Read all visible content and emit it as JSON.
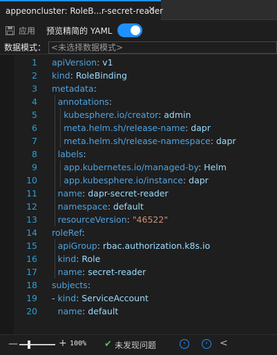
{
  "tab": {
    "title": "appeoncluster: RoleB...r-secret-reader",
    "close_glyph": "✕"
  },
  "toolbar": {
    "apply_label": "应用",
    "simplified_label": "预览精简的 YAML",
    "simplified_enabled": true
  },
  "mode": {
    "label": "数据模式：",
    "placeholder": "<未选择数据模式>"
  },
  "editor": {
    "lines": [
      {
        "n": "1",
        "indent": 0,
        "key": "apiVersion",
        "val": "v1",
        "type": "v"
      },
      {
        "n": "2",
        "indent": 0,
        "key": "kind",
        "val": "RoleBinding",
        "type": "v"
      },
      {
        "n": "3",
        "indent": 0,
        "key": "metadata",
        "val": "",
        "type": "v"
      },
      {
        "n": "4",
        "indent": 1,
        "key": "annotations",
        "val": "",
        "type": "v"
      },
      {
        "n": "5",
        "indent": 2,
        "key": "kubesphere.io/creator",
        "val": "admin",
        "type": "v"
      },
      {
        "n": "6",
        "indent": 2,
        "key": "meta.helm.sh/release-name",
        "val": "dapr",
        "type": "v"
      },
      {
        "n": "7",
        "indent": 2,
        "key": "meta.helm.sh/release-namespace",
        "val": "dapr",
        "type": "v"
      },
      {
        "n": "8",
        "indent": 1,
        "key": "labels",
        "val": "",
        "type": "v"
      },
      {
        "n": "9",
        "indent": 2,
        "key": "app.kubernetes.io/managed-by",
        "val": "Helm",
        "type": "v"
      },
      {
        "n": "10",
        "indent": 2,
        "key": "app.kubesphere.io/instance",
        "val": "dapr",
        "type": "v"
      },
      {
        "n": "11",
        "indent": 1,
        "key": "name",
        "val": "dapr-secret-reader",
        "type": "v"
      },
      {
        "n": "12",
        "indent": 1,
        "key": "namespace",
        "val": "default",
        "type": "v"
      },
      {
        "n": "13",
        "indent": 1,
        "key": "resourceVersion",
        "val": "\"46522\"",
        "type": "s"
      },
      {
        "n": "14",
        "indent": 0,
        "key": "roleRef",
        "val": "",
        "type": "v"
      },
      {
        "n": "15",
        "indent": 1,
        "key": "apiGroup",
        "val": "rbac.authorization.k8s.io",
        "type": "v"
      },
      {
        "n": "16",
        "indent": 1,
        "key": "kind",
        "val": "Role",
        "type": "v"
      },
      {
        "n": "17",
        "indent": 1,
        "key": "name",
        "val": "secret-reader",
        "type": "v"
      },
      {
        "n": "18",
        "indent": 0,
        "key": "subjects",
        "val": "",
        "type": "v"
      },
      {
        "n": "19",
        "indent": 0,
        "dash": true,
        "key": "kind",
        "val": "ServiceAccount",
        "type": "v"
      },
      {
        "n": "20",
        "indent": 1,
        "key": "name",
        "val": "default",
        "type": "v"
      }
    ]
  },
  "status": {
    "zoom_minus": "—",
    "zoom_plus": "+",
    "zoom_value": "100%",
    "ok_glyph": "✔",
    "problems_text": "未发现问题",
    "prev_glyph": "‹",
    "next_glyph": "›",
    "collapse_glyph": "<"
  },
  "colors": {
    "accent": "#1e90ff",
    "line_number": "#2aa0d6",
    "key": "#4fa3e0",
    "value": "#9cdcfe",
    "string": "#ce9178",
    "ok": "#4ec94e"
  }
}
